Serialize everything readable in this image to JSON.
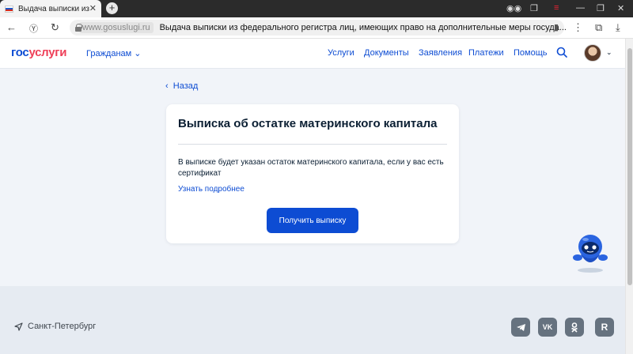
{
  "browser": {
    "tab_title": "Выдача выписки из фе",
    "tab_close": "✕",
    "new_tab": "+",
    "domain": "www.gosuslugi.ru",
    "page_title": "Выдача выписки из федерального регистра лиц, имеющих право на дополнительные меры госуда..."
  },
  "header": {
    "logo_gos": "гос",
    "logo_uslugi": "услуги",
    "citizens": "Гражданам",
    "menu": [
      "Услуги",
      "Документы",
      "Заявления",
      "Платежи",
      "Помощь"
    ]
  },
  "main": {
    "back": "Назад",
    "title": "Выписка об остатке материнского капитала",
    "text": "В выписке будет указан остаток материнского капитала, если у вас есть сертификат",
    "more_link": "Узнать подробнее",
    "button": "Получить выписку"
  },
  "footer": {
    "city": "Санкт-Петербург",
    "social": [
      "telegram-icon",
      "vk-icon",
      "ok-icon",
      "rutube-icon"
    ]
  },
  "colors": {
    "brand_blue": "#0d4cd3",
    "brand_red": "#ee3f58",
    "page_bg": "#f1f4f9",
    "footer_bg": "#e6ebf2"
  }
}
